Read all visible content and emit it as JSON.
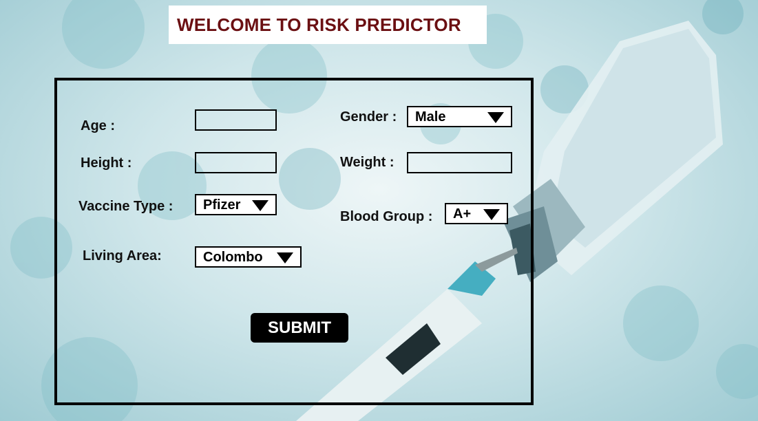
{
  "header": {
    "title": "WELCOME TO RISK PREDICTOR"
  },
  "form": {
    "age": {
      "label": "Age :",
      "value": ""
    },
    "height": {
      "label": "Height :",
      "value": ""
    },
    "vaccine_type": {
      "label": "Vaccine Type :",
      "selected": "Pfizer"
    },
    "living_area": {
      "label": "Living Area:",
      "selected": "Colombo"
    },
    "gender": {
      "label": "Gender :",
      "selected": "Male"
    },
    "weight": {
      "label": "Weight :",
      "value": ""
    },
    "blood_group": {
      "label": "Blood Group :",
      "selected": "A+"
    },
    "submit_label": "SUBMIT"
  },
  "colors": {
    "title_text": "#6b0f12",
    "frame": "#000000",
    "button_bg": "#000000",
    "button_text": "#ffffff"
  }
}
